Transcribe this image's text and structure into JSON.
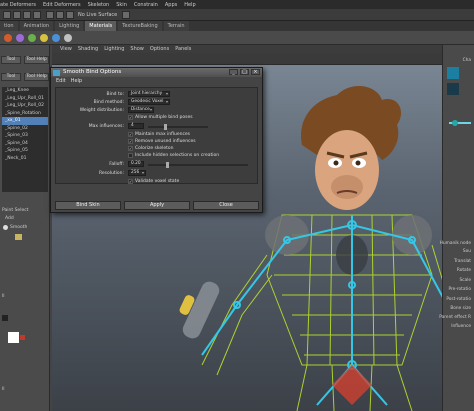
{
  "menubar": [
    "ate Deformers",
    "Edit Deformers",
    "Skeleton",
    "Skin",
    "Constrain",
    "Apps",
    "Help"
  ],
  "status": {
    "no_live": "No Live Surface"
  },
  "shelf_tabs": [
    {
      "label": "tion"
    },
    {
      "label": "Animation"
    },
    {
      "label": "Lighting"
    },
    {
      "label": "Materials",
      "active": true
    },
    {
      "label": "TextureBaking"
    },
    {
      "label": "Terrain"
    }
  ],
  "left_panel": {
    "tool_label": "Tool",
    "tool_help": "Tool Help",
    "tool_label2": "Tool",
    "tool_help2": "Tool Help",
    "outliner": [
      {
        "label": "_Leg_Knee",
        "selected": false
      },
      {
        "label": "_Leg_Upr_Roll_01",
        "selected": false
      },
      {
        "label": "_Leg_Upr_Roll_02",
        "selected": false
      },
      {
        "label": "_Spine_Rotation",
        "selected": false
      },
      {
        "label": "_xx_01",
        "selected": true
      },
      {
        "label": "_Spine_02",
        "selected": false
      },
      {
        "label": "_Spine_03",
        "selected": false
      },
      {
        "label": "_Spine_04",
        "selected": false
      },
      {
        "label": "_Spine_05",
        "selected": false
      },
      {
        "label": "_Neck_01",
        "selected": false
      }
    ],
    "paint_select": "Paint Select",
    "add": "Add",
    "smooth": "Smooth",
    "shelf_ctrl": "ll",
    "bottom_label": "ll"
  },
  "viewport_menu": [
    "View",
    "Shading",
    "Lighting",
    "Show",
    "Options",
    "Panels"
  ],
  "dialog": {
    "title": "Smooth Bind Options",
    "menu": [
      "Edit",
      "Help"
    ],
    "bind_to_label": "Bind to:",
    "bind_to_value": "Joint hierarchy",
    "bind_method_label": "Bind method:",
    "bind_method_value": "Geodesic Voxel",
    "weight_dist_label": "Weight distribution:",
    "weight_dist_value": "Distance",
    "allow_multiple": "Allow multiple bind poses",
    "max_influences_label": "Max influences:",
    "max_influences_value": "4",
    "maintain_max": "Maintain max influences",
    "remove_unused": "Remove unused influences",
    "colorize": "Colorize skeleton",
    "include_hidden": "Include hidden selections on creation",
    "falloff_label": "Falloff:",
    "falloff_value": "0.20",
    "resolution_label": "Resolution:",
    "resolution_value": "256",
    "validate": "Validate voxel state",
    "btn_bind": "Bind Skin",
    "btn_apply": "Apply",
    "btn_close": "Close"
  },
  "right_panel": {
    "labels": [
      "Cha",
      "Humanik node",
      "Sou",
      "Translat",
      "Rotate",
      "Scale",
      "Pre-rotatio",
      "Post-rotatio",
      "Bone size",
      "Parent effect R",
      "Influence"
    ]
  },
  "colors": {
    "selection": "#5281b9",
    "wire_green": "#b8e02a",
    "wire_cyan": "#35c7e6"
  }
}
